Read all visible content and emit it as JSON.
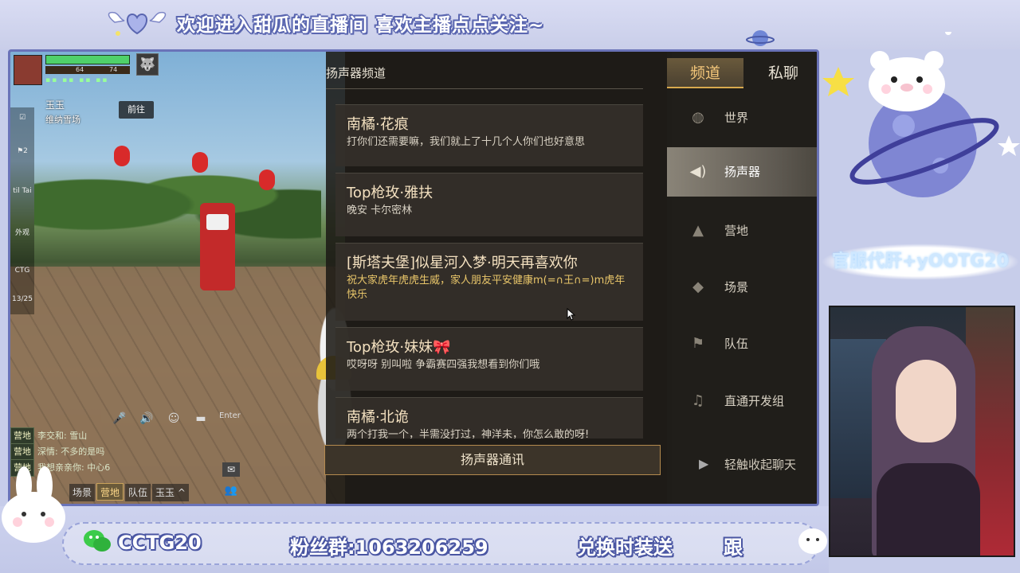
{
  "overlay": {
    "banner": "欢迎进入甜瓜的直播间 喜欢主播点点关注~",
    "wechat": "CCTG20",
    "fan_group": "粉丝群:1063206259",
    "exchange": "兑换时装送",
    "follow": "跟",
    "cloud_text": "官服代肝+yOOTG20"
  },
  "game": {
    "hud": {
      "stat_left": "64",
      "stat_right": "74",
      "status_icons": "▪▪ ▪▪ ▪▪ ▪▪"
    },
    "location": {
      "name": "玉玉",
      "sub": "维纳雪场",
      "goto": "前往"
    },
    "side_tools": [
      "☑",
      "⚑2",
      "til Tai",
      "外观",
      "CTG",
      "13/25"
    ],
    "chat_icons": [
      "mic-icon",
      "speaker-icon",
      "person-icon",
      "chat-icon"
    ],
    "enter_label": "Enter",
    "chat_log": [
      {
        "tag": "营地",
        "text": "李交和: 雪山"
      },
      {
        "tag": "营地",
        "text": "深情: 不多的是吗"
      },
      {
        "tag": "营地",
        "text": "我想亲亲你: 中心6"
      }
    ],
    "chat_tabs": [
      {
        "label": "场景",
        "active": false
      },
      {
        "label": "营地",
        "active": true
      },
      {
        "label": "队伍",
        "active": false
      },
      {
        "label": "玉玉 ^",
        "active": false
      }
    ],
    "panel": {
      "title": "扬声器频道",
      "messages": [
        {
          "name": "南橘·花痕",
          "text": "打你们还需要嘛，我们就上了十几个人你们也好意思",
          "gold": false
        },
        {
          "name": "Top枪玫·雅扶",
          "text": "晚安  卡尔密林",
          "gold": false
        },
        {
          "name": "[斯塔夫堡]似星河入梦·明天再喜欢你",
          "text": "祝大家虎年虎虎生威，家人朋友平安健康m(=∩王∩=)m虎年快乐",
          "gold": true
        },
        {
          "name": "Top枪玫·妹妹🎀",
          "text": "哎呀呀 别叫啦 争霸赛四强我想看到你们哦",
          "gold": false
        },
        {
          "name": "南橘·北诡",
          "text": "两个打我一个，半需没打过，神洋未，你怎么敢的呀!",
          "gold": false
        }
      ],
      "speaker_button": "扬声器通讯"
    },
    "sidebar": {
      "tabs": [
        {
          "label": "频道",
          "active": true
        },
        {
          "label": "私聊",
          "active": false
        }
      ],
      "channels": [
        {
          "label": "世界",
          "icon": "globe-icon",
          "active": false
        },
        {
          "label": "扬声器",
          "icon": "speaker-icon",
          "active": true
        },
        {
          "label": "营地",
          "icon": "camp-icon",
          "active": false
        },
        {
          "label": "场景",
          "icon": "scene-icon",
          "active": false
        },
        {
          "label": "队伍",
          "icon": "flag-icon",
          "active": false
        },
        {
          "label": "直通开发组",
          "icon": "dev-icon",
          "active": false
        }
      ],
      "collapse": "轻触收起聊天"
    }
  }
}
